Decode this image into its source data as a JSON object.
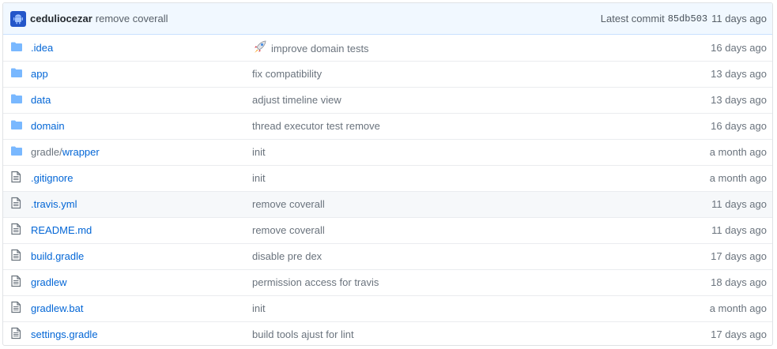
{
  "commit": {
    "author": "ceduliocezar",
    "message": "remove coverall",
    "latest_label": "Latest commit",
    "sha": "85db503",
    "age": "11 days ago",
    "avatar_icon": "android-avatar-icon"
  },
  "files": [
    {
      "type": "dir",
      "name": ".idea",
      "dir_prefix": "",
      "message": "improve domain tests",
      "emoji": "rocket-icon",
      "age": "16 days ago"
    },
    {
      "type": "dir",
      "name": "app",
      "dir_prefix": "",
      "message": "fix compatibility",
      "emoji": "",
      "age": "13 days ago"
    },
    {
      "type": "dir",
      "name": "data",
      "dir_prefix": "",
      "message": "adjust timeline view",
      "emoji": "",
      "age": "13 days ago"
    },
    {
      "type": "dir",
      "name": "domain",
      "dir_prefix": "",
      "message": "thread executor test remove",
      "emoji": "",
      "age": "16 days ago"
    },
    {
      "type": "dir",
      "name": "wrapper",
      "dir_prefix": "gradle/",
      "message": "init",
      "emoji": "",
      "age": "a month ago"
    },
    {
      "type": "file",
      "name": ".gitignore",
      "dir_prefix": "",
      "message": "init",
      "emoji": "",
      "age": "a month ago"
    },
    {
      "type": "file",
      "name": ".travis.yml",
      "dir_prefix": "",
      "message": "remove coverall",
      "emoji": "",
      "age": "11 days ago"
    },
    {
      "type": "file",
      "name": "README.md",
      "dir_prefix": "",
      "message": "remove coverall",
      "emoji": "",
      "age": "11 days ago"
    },
    {
      "type": "file",
      "name": "build.gradle",
      "dir_prefix": "",
      "message": "disable pre dex",
      "emoji": "",
      "age": "17 days ago"
    },
    {
      "type": "file",
      "name": "gradlew",
      "dir_prefix": "",
      "message": "permission access for travis",
      "emoji": "",
      "age": "18 days ago"
    },
    {
      "type": "file",
      "name": "gradlew.bat",
      "dir_prefix": "",
      "message": "init",
      "emoji": "",
      "age": "a month ago"
    },
    {
      "type": "file",
      "name": "settings.gradle",
      "dir_prefix": "",
      "message": "build tools ajust for lint",
      "emoji": "",
      "age": "17 days ago"
    }
  ],
  "colors": {
    "link": "#0366d6",
    "folder_icon": "#79b8ff",
    "file_icon": "#6a737d",
    "header_bg": "#f1f8ff"
  }
}
